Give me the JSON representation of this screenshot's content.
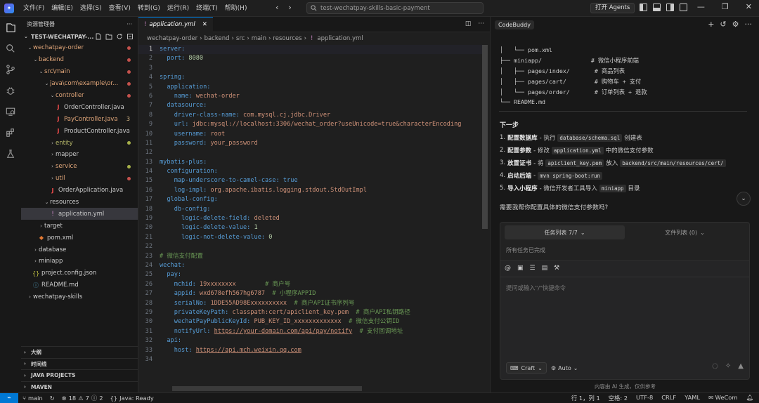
{
  "titlebar": {
    "menus": [
      "文件(F)",
      "编辑(E)",
      "选择(S)",
      "查看(V)",
      "转到(G)",
      "运行(R)",
      "终端(T)",
      "帮助(H)"
    ],
    "search_text": "test-wechatpay-skills-basic-payment",
    "agents_button": "打开 Agents"
  },
  "sidebar": {
    "header": "资源管理器",
    "root": "TEST-WECHATPAY-...",
    "tree": [
      {
        "label": "wechatpay-order",
        "indent": 1,
        "type": "folder-open",
        "color": "#e2a77a",
        "dot": "#c5524d"
      },
      {
        "label": "backend",
        "indent": 2,
        "type": "folder-open",
        "color": "#e2a77a",
        "dot": "#c5524d"
      },
      {
        "label": "src\\main",
        "indent": 3,
        "type": "folder-open",
        "color": "#e2a77a",
        "dot": "#c5524d"
      },
      {
        "label": "java\\com\\example\\or...",
        "indent": 4,
        "type": "folder-open",
        "color": "#e2a77a",
        "dot": "#c5524d"
      },
      {
        "label": "controller",
        "indent": 5,
        "type": "folder-open",
        "color": "#e2a77a",
        "dot": "#c5524d"
      },
      {
        "label": "OrderController.java",
        "indent": 6,
        "type": "java",
        "color": "#cccccc"
      },
      {
        "label": "PayController.java",
        "indent": 6,
        "type": "java",
        "color": "#e2a77a",
        "num": "3"
      },
      {
        "label": "ProductController.java",
        "indent": 6,
        "type": "java",
        "color": "#cccccc"
      },
      {
        "label": "entity",
        "indent": 5,
        "type": "folder",
        "color": "#b8b96a",
        "dot": "#a7b14a"
      },
      {
        "label": "mapper",
        "indent": 5,
        "type": "folder",
        "color": "#cccccc"
      },
      {
        "label": "service",
        "indent": 5,
        "type": "folder",
        "color": "#e2a77a",
        "dot": "#a7b14a"
      },
      {
        "label": "util",
        "indent": 5,
        "type": "folder",
        "color": "#e2a77a",
        "dot": "#c5524d"
      },
      {
        "label": "OrderApplication.java",
        "indent": 5,
        "type": "java",
        "color": "#cccccc"
      },
      {
        "label": "resources",
        "indent": 4,
        "type": "folder-open",
        "color": "#cccccc"
      },
      {
        "label": "application.yml",
        "indent": 5,
        "type": "yml",
        "color": "#cccccc",
        "selected": true
      },
      {
        "label": "target",
        "indent": 3,
        "type": "folder",
        "color": "#cccccc"
      },
      {
        "label": "pom.xml",
        "indent": 3,
        "type": "xml",
        "color": "#cccccc"
      },
      {
        "label": "database",
        "indent": 2,
        "type": "folder",
        "color": "#cccccc"
      },
      {
        "label": "miniapp",
        "indent": 2,
        "type": "folder",
        "color": "#cccccc"
      },
      {
        "label": "project.config.json",
        "indent": 2,
        "type": "json",
        "color": "#cccccc"
      },
      {
        "label": "README.md",
        "indent": 2,
        "type": "info",
        "color": "#cccccc"
      },
      {
        "label": "wechatpay-skills",
        "indent": 1,
        "type": "folder",
        "color": "#cccccc"
      }
    ],
    "sections": [
      "大纲",
      "时间线",
      "JAVA PROJECTS",
      "MAVEN"
    ]
  },
  "editor": {
    "tab_label": "application.yml",
    "breadcrumb": [
      "wechatpay-order",
      "backend",
      "src",
      "main",
      "resources",
      "application.yml"
    ],
    "lines": [
      [
        [
          "k",
          "server:"
        ]
      ],
      [
        [
          "k",
          "  port: "
        ],
        [
          "n",
          "8080"
        ]
      ],
      [],
      [
        [
          "k",
          "spring:"
        ]
      ],
      [
        [
          "k",
          "  application:"
        ]
      ],
      [
        [
          "k",
          "    name: "
        ],
        [
          "v",
          "wechat-order"
        ]
      ],
      [
        [
          "k",
          "  datasource:"
        ]
      ],
      [
        [
          "k",
          "    driver-class-name: "
        ],
        [
          "v",
          "com.mysql.cj.jdbc.Driver"
        ]
      ],
      [
        [
          "k",
          "    url: "
        ],
        [
          "v",
          "jdbc:mysql://localhost:3306/wechat_order?useUnicode=true&characterEncoding"
        ]
      ],
      [
        [
          "k",
          "    username: "
        ],
        [
          "v",
          "root"
        ]
      ],
      [
        [
          "k",
          "    password: "
        ],
        [
          "v",
          "your_password"
        ]
      ],
      [],
      [
        [
          "k",
          "mybatis-plus:"
        ]
      ],
      [
        [
          "k",
          "  configuration:"
        ]
      ],
      [
        [
          "k",
          "    map-underscore-to-camel-case: "
        ],
        [
          "k",
          "true"
        ]
      ],
      [
        [
          "k",
          "    log-impl: "
        ],
        [
          "v",
          "org.apache.ibatis.logging.stdout.StdOutImpl"
        ]
      ],
      [
        [
          "k",
          "  global-config:"
        ]
      ],
      [
        [
          "k",
          "    db-config:"
        ]
      ],
      [
        [
          "k",
          "      logic-delete-field: "
        ],
        [
          "v",
          "deleted"
        ]
      ],
      [
        [
          "k",
          "      logic-delete-value: "
        ],
        [
          "n",
          "1"
        ]
      ],
      [
        [
          "k",
          "      logic-not-delete-value: "
        ],
        [
          "n",
          "0"
        ]
      ],
      [],
      [
        [
          "c",
          "# 微信支付配置"
        ]
      ],
      [
        [
          "k",
          "wechat:"
        ]
      ],
      [
        [
          "k",
          "  pay:"
        ]
      ],
      [
        [
          "k",
          "    mchid: "
        ],
        [
          "v",
          "19xxxxxxxx"
        ],
        [
          "c",
          "        # 商户号"
        ]
      ],
      [
        [
          "k",
          "    appid: "
        ],
        [
          "v",
          "wxd678efh567hg6787"
        ],
        [
          "c",
          "  # 小程序APPID"
        ]
      ],
      [
        [
          "k",
          "    serialNo: "
        ],
        [
          "v",
          "1DDE55AD98Exxxxxxxxxx"
        ],
        [
          "c",
          "  # 商户API证书序列号"
        ]
      ],
      [
        [
          "k",
          "    privateKeyPath: "
        ],
        [
          "v",
          "classpath:cert/apiclient_key.pem"
        ],
        [
          "c",
          "  # 商户API私钥路径"
        ]
      ],
      [
        [
          "k",
          "    wechatPayPublicKeyId: "
        ],
        [
          "v",
          "PUB_KEY_ID_xxxxxxxxxxxxx"
        ],
        [
          "c",
          "  # 微信支付公钥ID"
        ]
      ],
      [
        [
          "k",
          "    notifyUrl: "
        ],
        [
          "u",
          "https://your-domain.com/api/pay/notify"
        ],
        [
          "c",
          "  # 支付回调地址"
        ]
      ],
      [
        [
          "k",
          "  api:"
        ]
      ],
      [
        [
          "k",
          "    host: "
        ],
        [
          "u",
          "https://api.mch.weixin.qq.com"
        ]
      ],
      []
    ]
  },
  "panel": {
    "tab": "CodeBuddy",
    "tree_lines": [
      "│   └── pom.xml",
      "├── miniapp/              # 微信小程序前端",
      "│   ├── pages/index/       # 商品列表",
      "│   ├── pages/cart/        # 购物车 + 支付",
      "│   └── pages/order/       # 订单列表 + 退款",
      "└── README.md"
    ],
    "steps_title": "下一步",
    "steps": [
      {
        "n": "1.",
        "bold": "配置数据库",
        "parts": [
          [
            "t",
            " - 执行 "
          ],
          [
            "c",
            "database/schema.sql"
          ],
          [
            "t",
            " 创建表"
          ]
        ]
      },
      {
        "n": "2.",
        "bold": "配置参数",
        "parts": [
          [
            "t",
            " - 修改 "
          ],
          [
            "c",
            "application.yml"
          ],
          [
            "t",
            " 中的微信支付参数"
          ]
        ]
      },
      {
        "n": "3.",
        "bold": "放置证书",
        "parts": [
          [
            "t",
            " - 将 "
          ],
          [
            "c",
            "apiclient_key.pem"
          ],
          [
            "t",
            " 放入 "
          ],
          [
            "c",
            "backend/src/main/resources/cert/"
          ]
        ]
      },
      {
        "n": "4.",
        "bold": "启动后端",
        "parts": [
          [
            "t",
            " - "
          ],
          [
            "c",
            "mvn spring-boot:run"
          ]
        ]
      },
      {
        "n": "5.",
        "bold": "导入小程序",
        "parts": [
          [
            "t",
            " - 微信开发者工具导入 "
          ],
          [
            "c",
            "miniapp"
          ],
          [
            "t",
            " 目录"
          ]
        ]
      }
    ],
    "question": "需要我帮你配置具体的微信支付参数吗?",
    "task_tab_active": "任务列表 7/7",
    "task_tab_inactive": "文件列表 (0)",
    "task_status": "所有任务已完成",
    "input_placeholder": "提问或输入\"/\"快捷命令",
    "craft_label": "Craft",
    "auto_label": "Auto",
    "disclaimer": "内容由 AI 生成，仅供参考"
  },
  "statusbar": {
    "branch": "main",
    "errors": "18",
    "warnings": "7",
    "infos": "2",
    "java": "Java: Ready",
    "position": "行 1，列 1",
    "spaces": "空格: 2",
    "encoding": "UTF-8",
    "eol": "CRLF",
    "language": "YAML",
    "wecom": "WeCom"
  }
}
